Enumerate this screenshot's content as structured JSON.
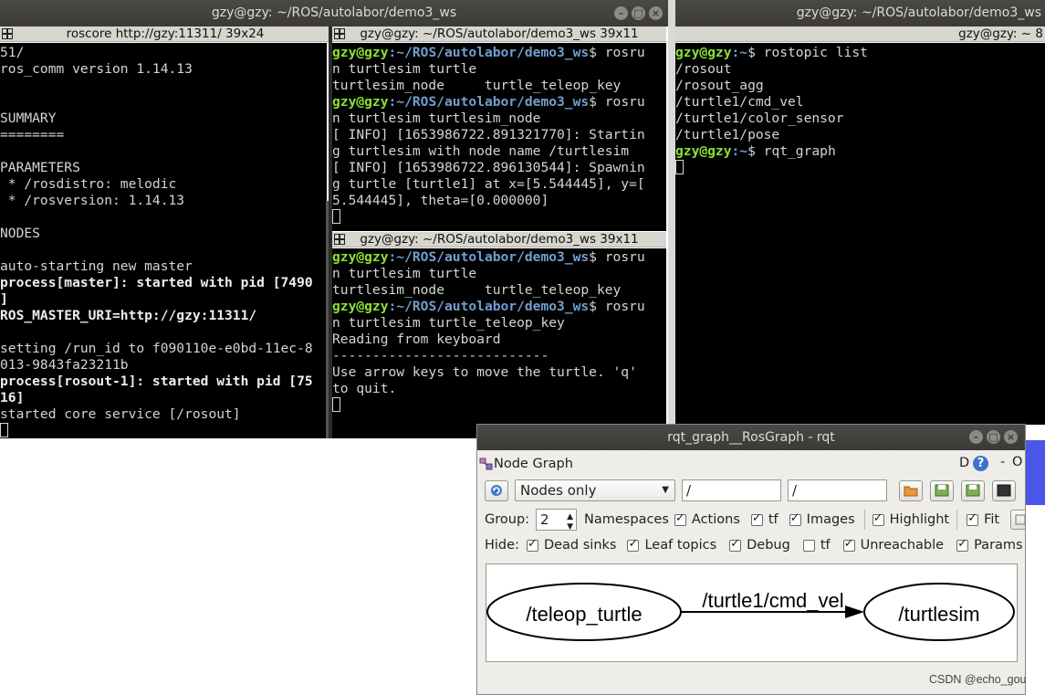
{
  "windows": {
    "main_terminal_title": "gzy@gzy: ~/ROS/autolabor/demo3_ws",
    "right_terminal_title": "gzy@gzy: ~/ROS/autolabor/demo3_ws"
  },
  "terminals": {
    "roscore": {
      "tab": "roscore http://gzy:11311/ 39x24",
      "lines": [
        {
          "t": "51/",
          "cls": ""
        },
        {
          "t": "ros_comm version 1.14.13",
          "cls": ""
        },
        {
          "t": "",
          "cls": ""
        },
        {
          "t": "",
          "cls": ""
        },
        {
          "t": "SUMMARY",
          "cls": ""
        },
        {
          "t": "========",
          "cls": ""
        },
        {
          "t": "",
          "cls": ""
        },
        {
          "t": "PARAMETERS",
          "cls": ""
        },
        {
          "t": " * /rosdistro: melodic",
          "cls": ""
        },
        {
          "t": " * /rosversion: 1.14.13",
          "cls": ""
        },
        {
          "t": "",
          "cls": ""
        },
        {
          "t": "NODES",
          "cls": ""
        },
        {
          "t": "",
          "cls": ""
        },
        {
          "t": "auto-starting new master",
          "cls": ""
        },
        {
          "t": "process[master]: started with pid [7490",
          "cls": "bold"
        },
        {
          "t": "]",
          "cls": "bold"
        },
        {
          "t": "ROS_MASTER_URI=http://gzy:11311/",
          "cls": "bold"
        },
        {
          "t": "",
          "cls": ""
        },
        {
          "t": "setting /run_id to f090110e-e0bd-11ec-8",
          "cls": ""
        },
        {
          "t": "013-9843fa23211b",
          "cls": ""
        },
        {
          "t": "process[rosout-1]: started with pid [75",
          "cls": "bold"
        },
        {
          "t": "16]",
          "cls": "bold"
        },
        {
          "t": "started core service [/rosout]",
          "cls": ""
        }
      ]
    },
    "top_middle": {
      "tab": "gzy@gzy: ~/ROS/autolabor/demo3_ws 39x11",
      "lines": [
        {
          "prompt": true,
          "user": "gzy@gzy",
          "path": ":~/ROS/autolabor/demo3_ws",
          "rest": "$ rosru"
        },
        {
          "t": "n turtlesim turtle"
        },
        {
          "t": "turtlesim_node     turtle_teleop_key"
        },
        {
          "prompt": true,
          "user": "gzy@gzy",
          "path": ":~/ROS/autolabor/demo3_ws",
          "rest": "$ rosru"
        },
        {
          "t": "n turtlesim turtlesim_node"
        },
        {
          "t": "[ INFO] [1653986722.891321770]: Startin"
        },
        {
          "t": "g turtlesim with node name /turtlesim"
        },
        {
          "t": "[ INFO] [1653986722.896130544]: Spawnin"
        },
        {
          "t": "g turtle [turtle1] at x=[5.544445], y=["
        },
        {
          "t": "5.544445], theta=[0.000000]"
        }
      ]
    },
    "bottom_middle": {
      "tab": "gzy@gzy: ~/ROS/autolabor/demo3_ws 39x11",
      "lines": [
        {
          "prompt": true,
          "user": "gzy@gzy",
          "path": ":~/ROS/autolabor/demo3_ws",
          "rest": "$ rosru"
        },
        {
          "t": "n turtlesim turtle"
        },
        {
          "t": "turtlesim_node     turtle_teleop_key"
        },
        {
          "prompt": true,
          "user": "gzy@gzy",
          "path": ":~/ROS/autolabor/demo3_ws",
          "rest": "$ rosru"
        },
        {
          "t": "n turtlesim turtle_teleop_key"
        },
        {
          "t": "Reading from keyboard"
        },
        {
          "t": "---------------------------"
        },
        {
          "t": "Use arrow keys to move the turtle. 'q'"
        },
        {
          "t": "to quit."
        }
      ]
    },
    "right": {
      "tab": "gzy@gzy: ~ 8",
      "lines": [
        {
          "prompt": true,
          "user": "gzy@gzy",
          "path": ":~",
          "rest": "$ rostopic list"
        },
        {
          "t": "/rosout"
        },
        {
          "t": "/rosout_agg"
        },
        {
          "t": "/turtle1/cmd_vel"
        },
        {
          "t": "/turtle1/color_sensor"
        },
        {
          "t": "/turtle1/pose"
        },
        {
          "prompt": true,
          "user": "gzy@gzy",
          "path": ":~",
          "rest": "$ rqt_graph"
        }
      ]
    }
  },
  "rqt": {
    "title": "rqt_graph__RosGraph - rqt",
    "plugin_title": "Node Graph",
    "plugin_btn_d": "D",
    "plugin_btn_help": "?",
    "plugin_dash": "-",
    "plugin_o": "O",
    "mode": "Nodes only",
    "filter1": "/",
    "filter2": "/",
    "group_label": "Group:",
    "group_value": "2",
    "opts_row1": [
      {
        "label": "Namespaces",
        "checked": true,
        "noBox": true
      },
      {
        "label": "Actions",
        "checked": true
      },
      {
        "label": "tf",
        "checked": true
      },
      {
        "label": "Images",
        "checked": true
      },
      {
        "label": "Highlight",
        "checked": true
      },
      {
        "label": "Fit",
        "checked": true
      }
    ],
    "hide_label": "Hide:",
    "opts_row2": [
      {
        "label": "Dead sinks",
        "checked": true
      },
      {
        "label": "Leaf topics",
        "checked": true
      },
      {
        "label": "Debug",
        "checked": true
      },
      {
        "label": "tf",
        "checked": false
      },
      {
        "label": "Unreachable",
        "checked": true
      },
      {
        "label": "Params",
        "checked": true
      }
    ],
    "graph": {
      "node_left": "/teleop_turtle",
      "node_right": "/turtlesim",
      "edge": "/turtle1/cmd_vel"
    }
  },
  "watermark": "CSDN @echo_gou",
  "colors": {
    "accent_blue": "#4a56e8"
  }
}
